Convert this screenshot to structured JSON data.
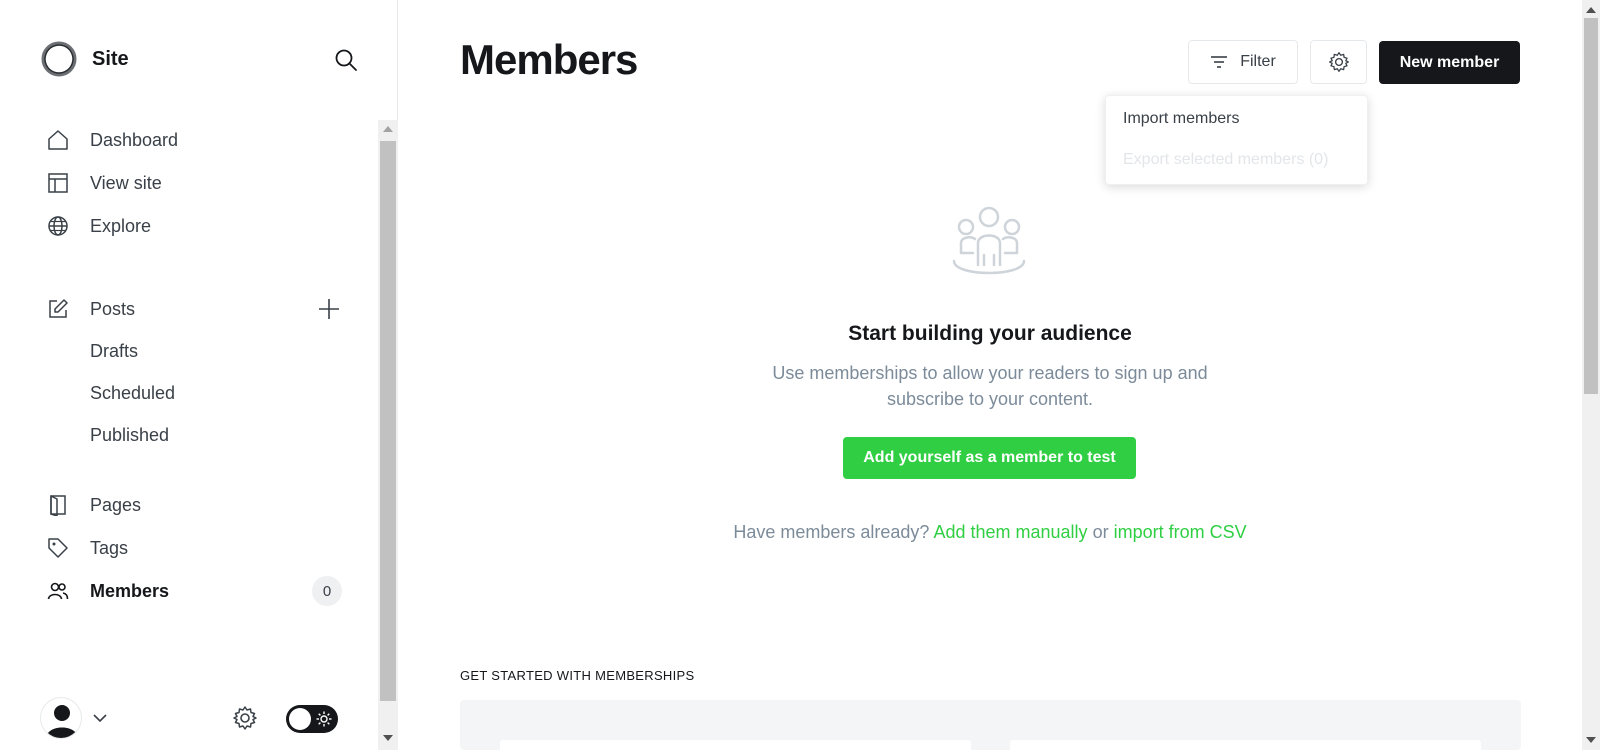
{
  "sidebar": {
    "brand": {
      "name": "Site",
      "logo_icon": "site-logo-icon"
    },
    "search_icon": "search-icon",
    "nav": {
      "dashboard": "Dashboard",
      "view_site": "View site",
      "explore": "Explore",
      "posts": "Posts",
      "drafts": "Drafts",
      "scheduled": "Scheduled",
      "published": "Published",
      "pages": "Pages",
      "tags": "Tags",
      "members": "Members",
      "members_count": "0"
    },
    "footer": {
      "theme_mode": "light"
    }
  },
  "header": {
    "title": "Members",
    "filter_label": "Filter",
    "new_member_label": "New member"
  },
  "dropdown": {
    "items": [
      {
        "label": "Import members",
        "enabled": true
      },
      {
        "label": "Export selected members (0)",
        "enabled": false
      }
    ]
  },
  "empty_state": {
    "title": "Start building your audience",
    "description": "Use memberships to allow your readers to sign up and subscribe to your content.",
    "cta_label": "Add yourself as a member to test",
    "have_prefix": "Have members already?",
    "add_manually": "Add them manually",
    "or_text": "or",
    "import_csv": "import from CSV"
  },
  "get_started": {
    "heading": "GET STARTED WITH MEMBERSHIPS"
  },
  "colors": {
    "accent": "#30cf43",
    "dark": "#15171a",
    "muted": "#7c8b9a"
  }
}
